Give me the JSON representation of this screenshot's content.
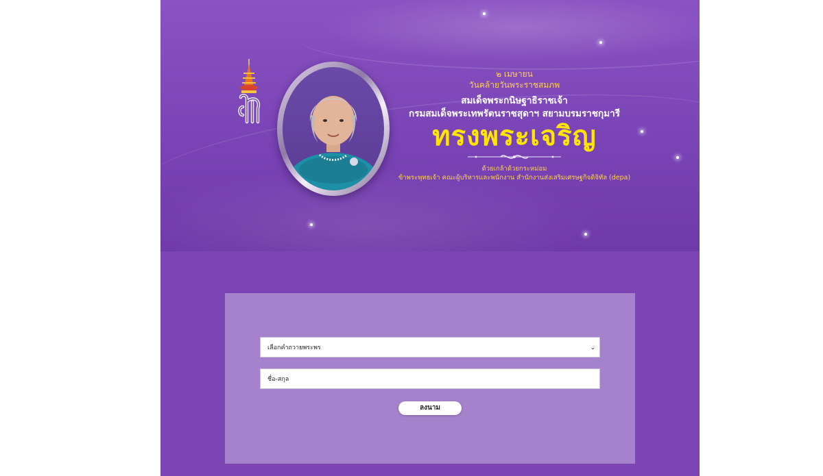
{
  "banner": {
    "date": "๒ เมษายน",
    "occasion": "วันคล้ายวันพระราชสมภพ",
    "royal_name_line1": "สมเด็จพระกนิษฐาธิราชเจ้า",
    "royal_name_line2": "กรมสมเด็จพระเทพรัตนราชสุดาฯ สยามบรมราชกุมารี",
    "title": "ทรงพระเจริญ",
    "tribute_line1": "ด้วยเกล้าด้วยกระหม่อม",
    "tribute_line2": "ข้าพระพุทธเจ้า คณะผู้บริหารและพนักงาน สำนักงานส่งเสริมเศรษฐกิจดิจิทัล (depa)"
  },
  "form": {
    "blessing_select": "เลือกคำถวายพระพร",
    "name_placeholder": "ชื่อ-สกุล",
    "submit_label": "ลงนาม"
  },
  "colors": {
    "background": "#7c45b3",
    "accent_yellow": "#ffe500",
    "date_gold": "#ffd24a"
  }
}
